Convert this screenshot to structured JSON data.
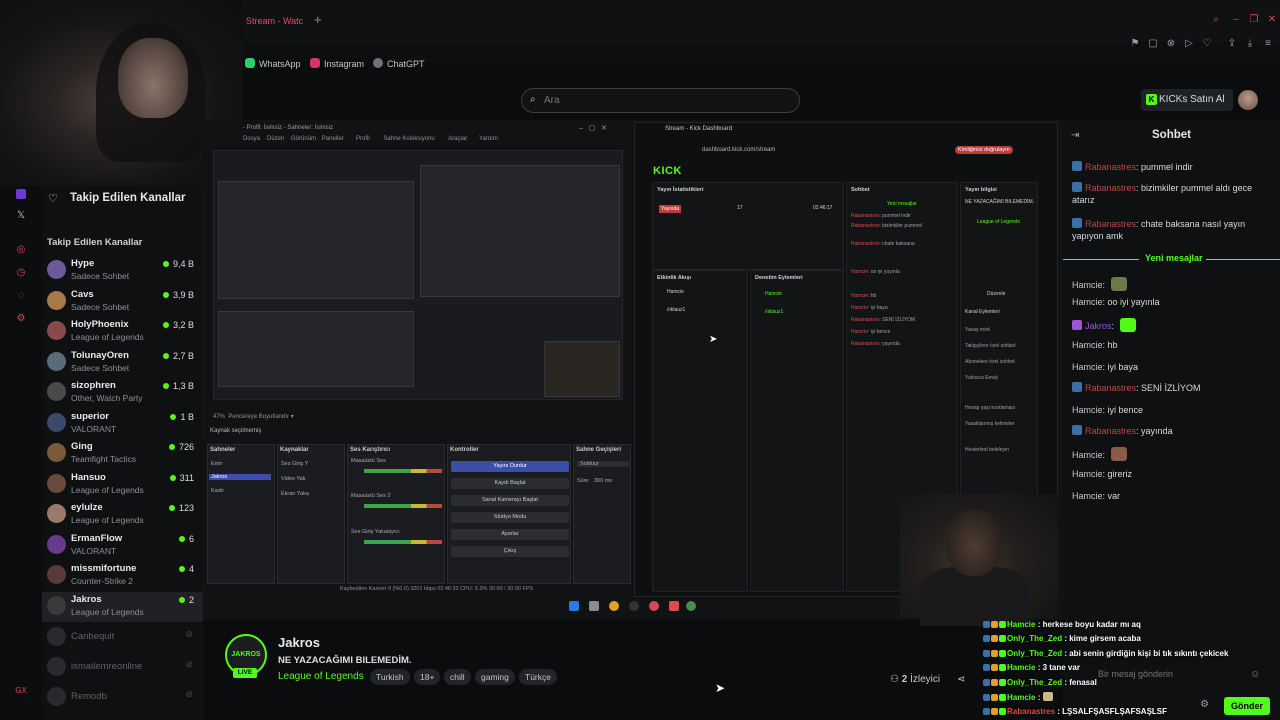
{
  "browser": {
    "tab_title": "Stream - Watc",
    "bookmarks": [
      "WhatsApp",
      "Instagram",
      "ChatGPT"
    ]
  },
  "search": {
    "placeholder": "Ara"
  },
  "header": {
    "kicks_label": "KICKs Satın Al"
  },
  "sidebar": {
    "title": "Takip Edilen Kanallar",
    "subtitle": "Takip Edilen Kanallar",
    "channels": [
      {
        "name": "Hype",
        "game": "Sadece Sohbet",
        "viewers": "9,4 B",
        "color": "#6b5a9a"
      },
      {
        "name": "Cavs",
        "game": "Sadece Sohbet",
        "viewers": "3,9 B",
        "color": "#a87a4a"
      },
      {
        "name": "HolyPhoenix",
        "game": "League of Legends",
        "viewers": "3,2 B",
        "color": "#8a4a4a"
      },
      {
        "name": "TolunayOren",
        "game": "Sadece Sohbet",
        "viewers": "2,7 B",
        "color": "#5a6a7a"
      },
      {
        "name": "sizophren",
        "game": "Other, Watch Party",
        "viewers": "1,3 B",
        "color": "#4a4a4a"
      },
      {
        "name": "superior",
        "game": "VALORANT",
        "viewers": "1 B",
        "color": "#3a4a6a"
      },
      {
        "name": "Ging",
        "game": "Teamfight Tactics",
        "viewers": "726",
        "color": "#7a5a3a"
      },
      {
        "name": "Hansuo",
        "game": "League of Legends",
        "viewers": "311",
        "color": "#6a4a3a"
      },
      {
        "name": "eylulze",
        "game": "League of Legends",
        "viewers": "123",
        "color": "#9a7a6a"
      },
      {
        "name": "ErmanFlow",
        "game": "VALORANT",
        "viewers": "6",
        "color": "#6a3a8a"
      },
      {
        "name": "missmifortune",
        "game": "Counter-Strike 2",
        "viewers": "4",
        "color": "#5a3a3a"
      },
      {
        "name": "Jakros",
        "game": "League of Legends",
        "viewers": "2",
        "color": "#3a3a3a"
      }
    ],
    "offline": [
      "Canbequit",
      "ismailemreonline",
      "Remodb"
    ]
  },
  "stream": {
    "name": "Jakros",
    "title": "NE YAZACAĞIMI BILEMEDİM.",
    "game": "League of Legends",
    "tags": [
      "Turkish",
      "18+",
      "chill",
      "gaming",
      "Türkçe"
    ],
    "viewers_count": "2",
    "viewers_label": "İzleyici",
    "live": "LIVE",
    "avatar_text": "JAKROS"
  },
  "chat": {
    "title": "Sohbet",
    "new_messages": "Yeni mesajlar",
    "messages": [
      {
        "user": "Rabanastres",
        "text": "pummel indir"
      },
      {
        "user": "Rabanastres",
        "text": "bizimkiler pummel aldı gece atarız"
      },
      {
        "user": "Rabanastres",
        "text": "chate baksana nasıl yayın yapıyon amk"
      },
      {
        "user": "Hamcie",
        "text": ""
      },
      {
        "user": "Hamcie",
        "text": "oo iyi yayınla"
      },
      {
        "user": "Jakros",
        "text": ""
      },
      {
        "user": "Hamcie",
        "text": "hb"
      },
      {
        "user": "Hamcie",
        "text": "iyi baya"
      },
      {
        "user": "Rabanastres",
        "text": "SENİ İZLİYOM"
      },
      {
        "user": "Hamcie",
        "text": "iyi bence"
      },
      {
        "user": "Rabanastres",
        "text": "yayında"
      },
      {
        "user": "Hamcie",
        "text": ""
      },
      {
        "user": "Hamcie",
        "text": "gireriz"
      },
      {
        "user": "Hamcie",
        "text": "var"
      }
    ],
    "input_placeholder": "Bir mesaj gönderin",
    "send": "Gönder"
  },
  "overlay_chat": [
    {
      "user": "Hamcie",
      "text": "herkese boyu kadar mı aq"
    },
    {
      "user": "Only_The_Zed",
      "text": "kime girsem acaba"
    },
    {
      "user": "Only_The_Zed",
      "text": "abi senin girdiğin kişi bi tık sıkıntı çekicek"
    },
    {
      "user": "Hamcie",
      "text": "3 tane var"
    },
    {
      "user": "Only_The_Zed",
      "text": "fenasal"
    },
    {
      "user": "Hamcie",
      "text": ""
    },
    {
      "user": "Rabanastres",
      "text": "LŞSALFŞASFLŞAFSAŞLSF"
    }
  ],
  "obs": {
    "window_title": "- Profil: İsimsiz - Sahneler: İsimsiz",
    "menu": [
      "Dosya",
      "Düzen",
      "Görünüm",
      "Paneller",
      "Profil",
      "Sahne Koleksiyonu",
      "Araçlar",
      "Yardım"
    ],
    "sources_label": "Kaynak seçilmemiş",
    "panels": [
      "Sahneler",
      "Kaynaklar",
      "Ses Karıştırıcı",
      "Kontroller",
      "Sahne Geçişleri"
    ],
    "scenes": [
      "Emir",
      "Jakros",
      "Kadır"
    ],
    "sources": [
      "Ses Giriş Y",
      "Video Yak",
      "Ekran Yaka"
    ],
    "mixer": [
      "Masaüstü Ses",
      "Masaüstü Ses 2",
      "Ses Giriş Yakalayıcı"
    ],
    "controls": [
      "Yayını Durdur",
      "Kaydı Başlat",
      "Sanal Kamerayı Başlat",
      "Stüdyo Modu",
      "Ayarlar",
      "Çıkış"
    ],
    "transition": "Solduur",
    "duration_label": "Süre",
    "duration": "300 ms",
    "status": "Kaybedilen Kareler 0 (%0.0)   3201 kbps   02:46:32   CPU: 5.3%   30.00 / 30.00 FPS"
  },
  "dashboard": {
    "tab": "Stream - Kick Dashboard",
    "url": "dashboard.kick.com/stream",
    "logo": "KICK",
    "cols": [
      "Yayın İstatistikleri",
      "Etkinlik Akışı",
      "Denetim Eylemleri",
      "Sohbet",
      "Yayın bilgisi"
    ],
    "stats": [
      "Yayında",
      "17",
      "02:46:17"
    ],
    "channel_game": "League of Legends",
    "channel_title": "NE YAZACAĞIMI BILEMEDİM.",
    "edit": "Düzenle",
    "actions": [
      "Kanal Eylemleri",
      "Yavaş mod",
      "Takipçilere özel sohbet",
      "Abonelere özel sohbet",
      "Yalnızca Emoji",
      "Yapay Zeka ile Sohbet Denetimi",
      "Hesap yaşı kısıtlaması",
      "Yasaklanmış kelimeler",
      "Hastefest ekle",
      "Hesterfest belirleyin"
    ],
    "chat_new": "Yeni mesajlar",
    "profile": "Kimliğinizi doğrulayın"
  }
}
